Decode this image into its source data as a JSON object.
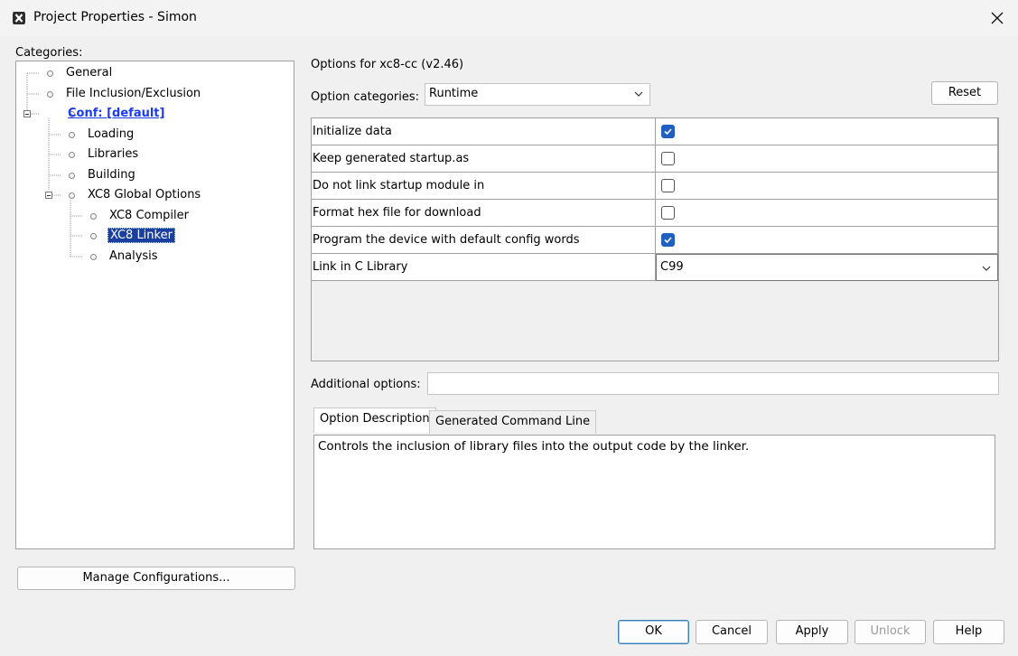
{
  "window": {
    "title": "Project Properties - Simon",
    "app_icon": "mplab-x-icon",
    "close_icon": "close-icon"
  },
  "categories": {
    "label": "Categories:",
    "tree": [
      {
        "label": "General"
      },
      {
        "label": "File Inclusion/Exclusion"
      },
      {
        "label": "Conf: [default]"
      },
      {
        "label": "Loading"
      },
      {
        "label": "Libraries"
      },
      {
        "label": "Building"
      },
      {
        "label": "XC8 Global Options"
      },
      {
        "label": "XC8 Compiler"
      },
      {
        "label": "XC8 Linker"
      },
      {
        "label": "Analysis"
      }
    ],
    "selected": "XC8 Linker"
  },
  "manage_button": "Manage Configurations...",
  "options": {
    "header": "Options for xc8-cc (v2.46)",
    "category_label": "Option categories:",
    "category_value": "Runtime",
    "reset_label": "Reset",
    "rows": [
      {
        "name": "Initialize data",
        "type": "checkbox",
        "checked": true
      },
      {
        "name": "Keep generated startup.as",
        "type": "checkbox",
        "checked": false
      },
      {
        "name": "Do not link startup module in",
        "type": "checkbox",
        "checked": false
      },
      {
        "name": "Format hex file for download",
        "type": "checkbox",
        "checked": false
      },
      {
        "name": "Program the device with default config words",
        "type": "checkbox",
        "checked": true
      },
      {
        "name": "Link in C Library",
        "type": "select",
        "value": "C99"
      }
    ],
    "additional_label": "Additional options:",
    "additional_value": ""
  },
  "tabs": [
    {
      "label": "Option Description",
      "active": true
    },
    {
      "label": "Generated Command Line",
      "active": false
    }
  ],
  "description": "Controls the inclusion of library files into the output code by the linker.",
  "footer": {
    "ok": "OK",
    "cancel": "Cancel",
    "apply": "Apply",
    "unlock": "Unlock",
    "help": "Help"
  },
  "colors": {
    "selection": "#1a3f9e",
    "link": "#1a3cf0",
    "checkbox_checked": "#1f5fc2"
  }
}
